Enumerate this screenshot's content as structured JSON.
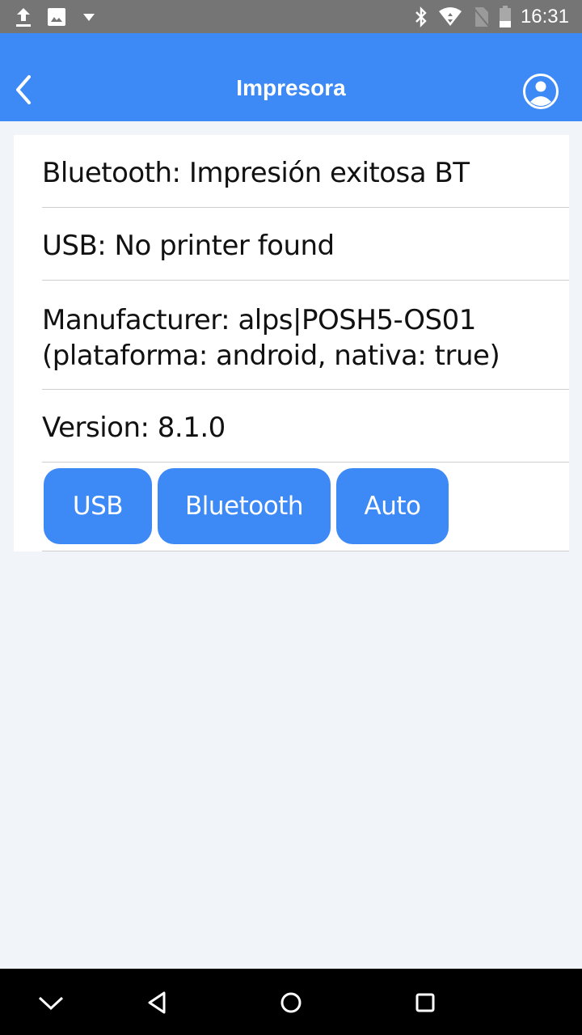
{
  "status_bar": {
    "time": "16:31",
    "left_icons": [
      "upload-icon",
      "image-icon",
      "dropdown-icon"
    ],
    "right_icons": [
      "bluetooth-icon",
      "wifi-icon",
      "no-sim-icon",
      "battery-icon"
    ]
  },
  "app_bar": {
    "title": "Impresora",
    "back_icon": "chevron-left-icon",
    "profile_icon": "user-circle-icon"
  },
  "info_rows": [
    {
      "label": "Bluetooth: Impresión exitosa BT"
    },
    {
      "label": "USB: No printer found"
    },
    {
      "line1": "Manufacturer: alps|POSH5-OS01",
      "line2": "(plataforma: android, nativa: true)"
    },
    {
      "label": "Version: 8.1.0"
    }
  ],
  "buttons": {
    "usb": "USB",
    "bluetooth": "Bluetooth",
    "auto": "Auto"
  },
  "colors": {
    "accent": "#3d8af7",
    "status_bar": "#757575",
    "background": "#f1f4f8"
  },
  "nav_bar": [
    "hide-keyboard-icon",
    "back-triangle-icon",
    "home-circle-icon",
    "recents-square-icon"
  ]
}
